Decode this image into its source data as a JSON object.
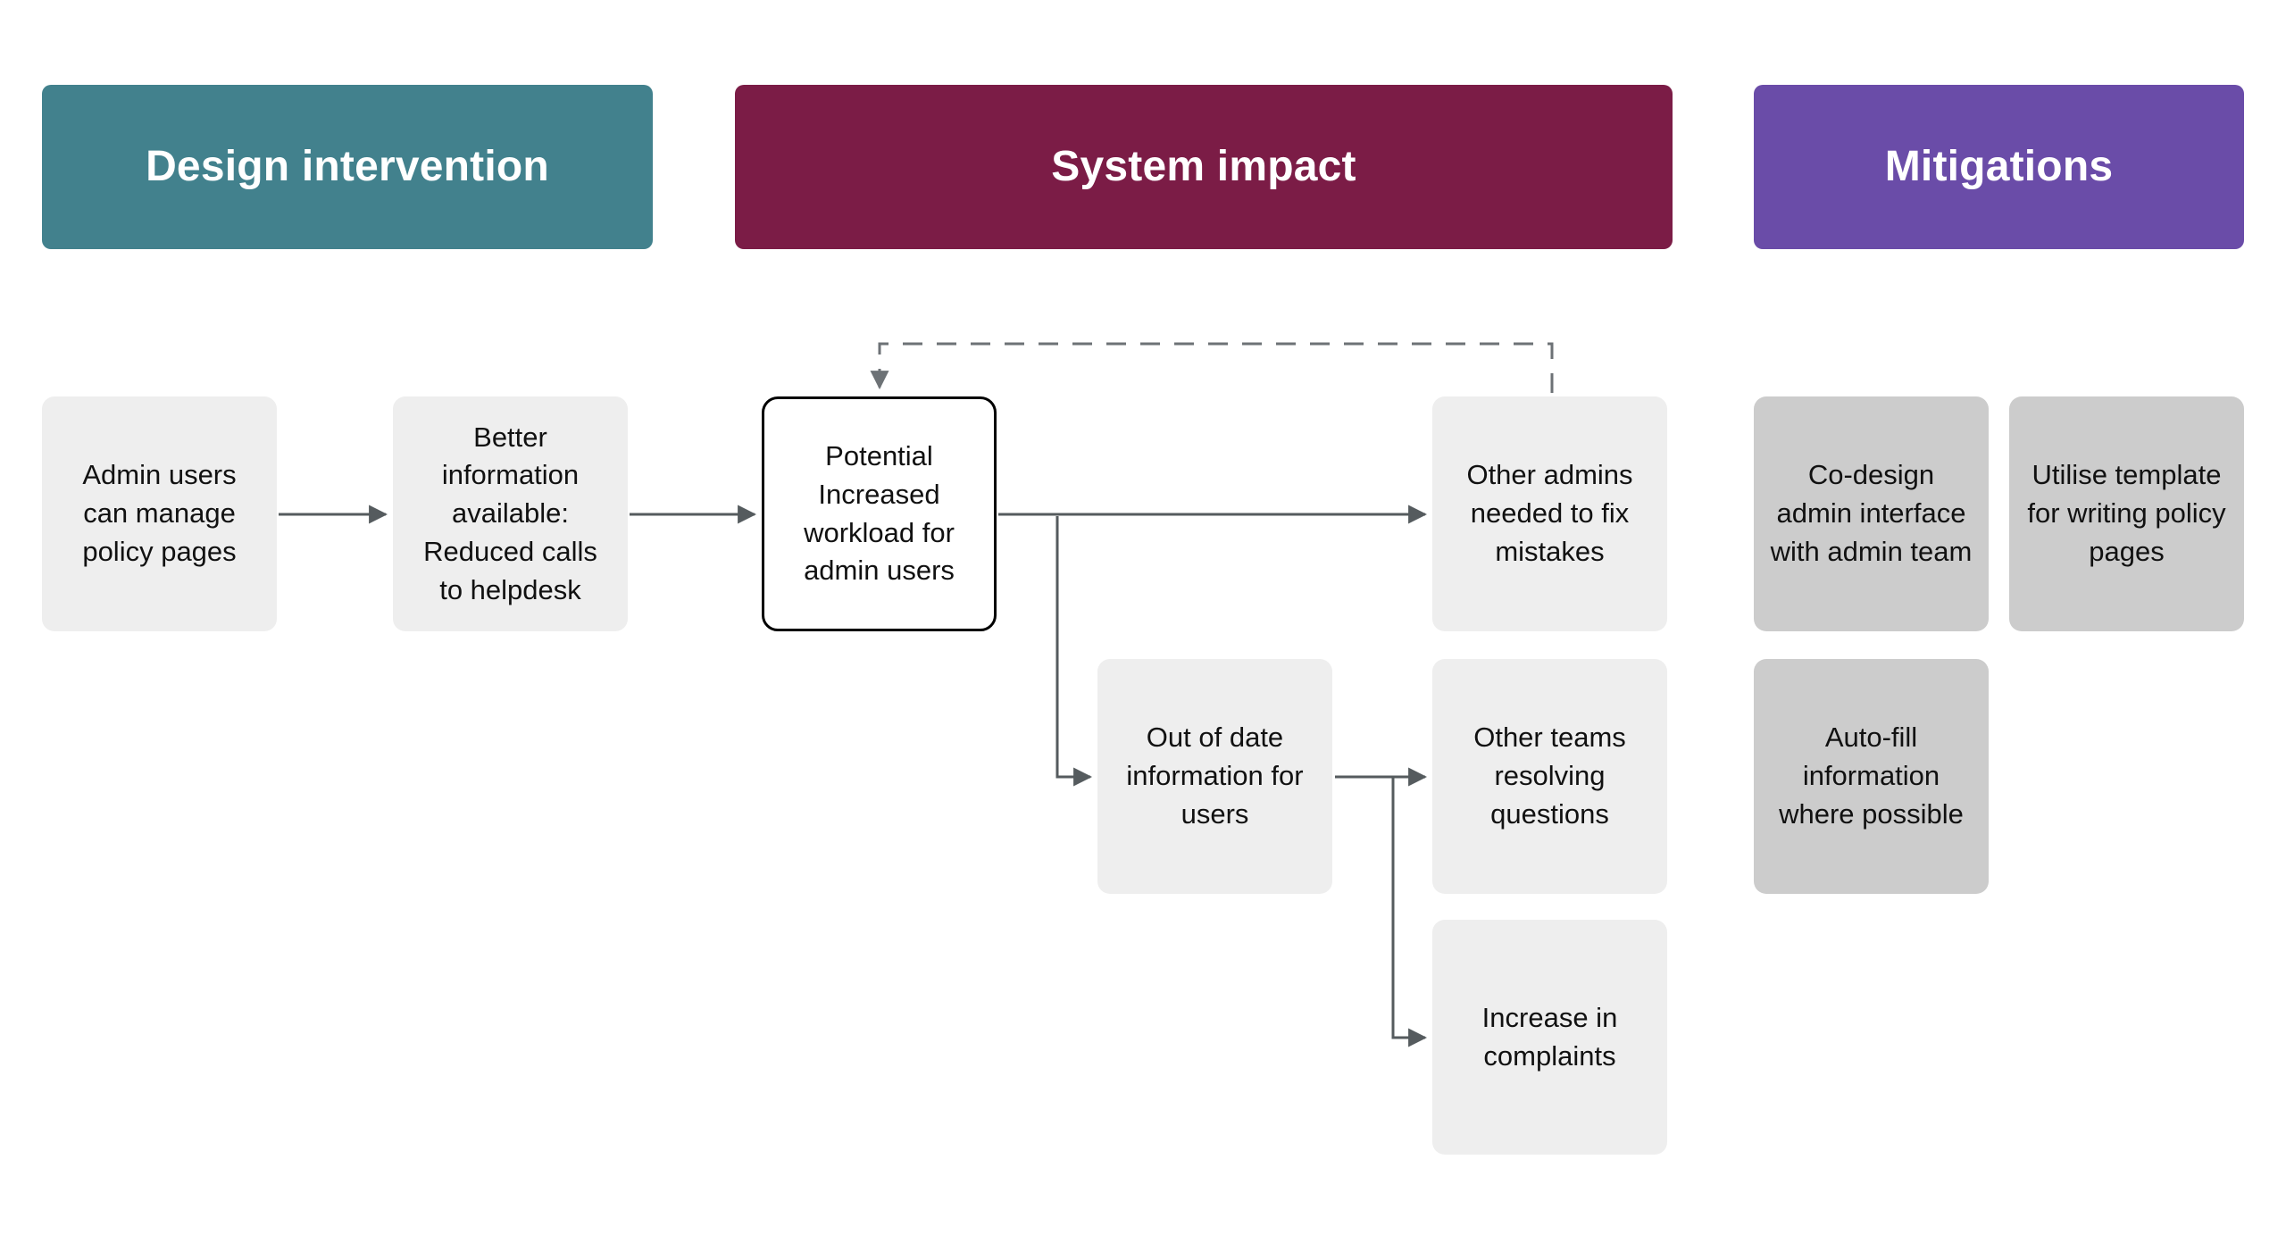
{
  "columns": [
    {
      "id": "design-intervention",
      "title": "Design intervention",
      "color": "#42818d"
    },
    {
      "id": "system-impact",
      "title": "System impact",
      "color": "#7b1c46"
    },
    {
      "id": "mitigations",
      "title": "Mitigations",
      "color": "#6a4ca8"
    }
  ],
  "nodes": {
    "admin_users": {
      "label": "Admin users can manage policy pages",
      "column": "design-intervention",
      "style": "light-grey"
    },
    "better_info": {
      "label": "Better information available: Reduced calls to helpdesk",
      "column": "design-intervention",
      "style": "light-grey"
    },
    "potential": {
      "label": "Potential Increased workload for admin users",
      "column": "system-impact",
      "style": "outlined-white"
    },
    "other_admins": {
      "label": "Other admins needed to fix mistakes",
      "column": "system-impact",
      "style": "light-grey"
    },
    "out_of_date": {
      "label": "Out of date information for users",
      "column": "system-impact",
      "style": "light-grey"
    },
    "other_teams": {
      "label": "Other teams resolving questions",
      "column": "system-impact",
      "style": "light-grey"
    },
    "complaints": {
      "label": "Increase in complaints",
      "column": "system-impact",
      "style": "light-grey"
    },
    "codesign": {
      "label": "Co-design admin interface with admin team",
      "column": "mitigations",
      "style": "mid-grey"
    },
    "template": {
      "label": "Utilise template for writing policy pages",
      "column": "mitigations",
      "style": "mid-grey"
    },
    "autofill": {
      "label": "Auto-fill information where possible",
      "column": "mitigations",
      "style": "mid-grey"
    }
  },
  "edges": [
    {
      "from": "admin_users",
      "to": "better_info",
      "style": "solid",
      "arrow": true
    },
    {
      "from": "better_info",
      "to": "potential",
      "style": "solid",
      "arrow": true
    },
    {
      "from": "potential",
      "to": "other_admins",
      "style": "solid",
      "arrow": true
    },
    {
      "from": "potential",
      "to": "out_of_date",
      "style": "solid",
      "arrow": true
    },
    {
      "from": "out_of_date",
      "to": "other_teams",
      "style": "solid",
      "arrow": true
    },
    {
      "from": "out_of_date",
      "to": "complaints",
      "style": "solid",
      "arrow": true
    },
    {
      "from": "other_admins",
      "to": "potential",
      "style": "dashed",
      "arrow": true
    }
  ],
  "colors": {
    "light_grey_node": "#eeeeee",
    "mid_grey_node": "#cccccc",
    "outlined_node_border": "#000000",
    "outlined_node_fill": "#ffffff",
    "connector": "#555b5e",
    "feedback_connector": "#6d7276",
    "node_text": "#111111",
    "header_text": "#ffffff",
    "background": "#ffffff"
  }
}
